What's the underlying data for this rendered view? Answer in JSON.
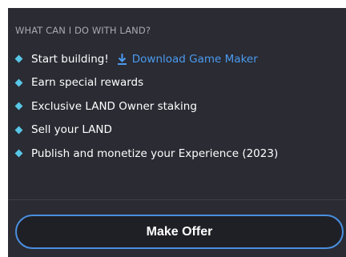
{
  "section": {
    "title": "WHAT CAN I DO WITH LAND?"
  },
  "features": [
    {
      "label": "Start building!",
      "link_label": "Download Game Maker",
      "link_icon": "download-icon"
    },
    {
      "label": "Earn special rewards"
    },
    {
      "label": "Exclusive LAND Owner staking"
    },
    {
      "label": "Sell your LAND"
    },
    {
      "label": "Publish and monetize your Experience (2023)"
    }
  ],
  "actions": {
    "make_offer_label": "Make Offer"
  },
  "colors": {
    "panel_bg": "#2a2b33",
    "bullet": "#58c6e6",
    "link": "#4b9bf0",
    "button_border": "#4a8fe0"
  }
}
